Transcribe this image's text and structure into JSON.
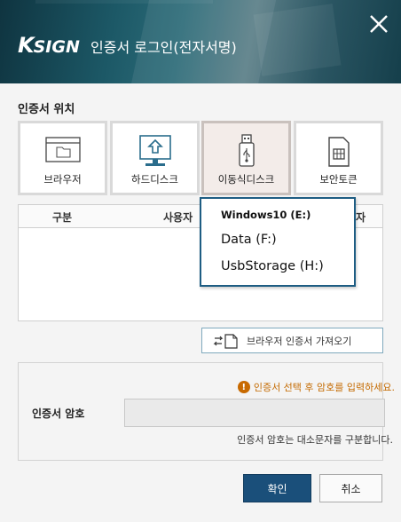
{
  "header": {
    "logo_k": "K",
    "logo_rest": "SIGN",
    "title": "인증서 로그인(전자서명)"
  },
  "location": {
    "label": "인증서 위치",
    "tiles": [
      {
        "label": "브라우저",
        "icon": "browser-folder-icon"
      },
      {
        "label": "하드디스크",
        "icon": "hard-disk-monitor-icon"
      },
      {
        "label": "이동식디스크",
        "icon": "usb-drive-icon",
        "selected": true
      },
      {
        "label": "보안토큰",
        "icon": "security-token-icon"
      }
    ]
  },
  "table": {
    "columns": [
      "구분",
      "사용자",
      "자"
    ]
  },
  "dropdown": {
    "header": "Windows10 (E:)",
    "items": [
      "Data (F:)",
      "UsbStorage (H:)"
    ]
  },
  "import_button": {
    "label": "브라우저 인증서 가져오기",
    "icon": "import-arrow-icon"
  },
  "password": {
    "warning": "인증서 선택 후 암호를 입력하세요.",
    "label": "인증서 암호",
    "hint": "인증서 암호는 대소문자를 구분합니다.",
    "value": ""
  },
  "buttons": {
    "ok": "확인",
    "cancel": "취소"
  },
  "colors": {
    "primary": "#1a4f7a",
    "warning": "#c86a00",
    "dropdown_border": "#1e5d83"
  }
}
